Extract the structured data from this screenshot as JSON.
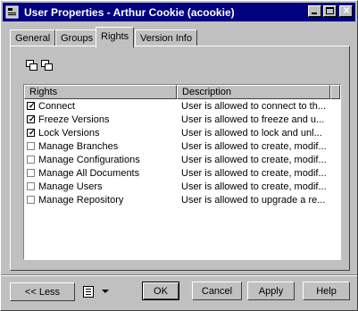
{
  "window": {
    "title": "User Properties - Arthur Cookie (acookie)"
  },
  "tabs": [
    {
      "label": "General"
    },
    {
      "label": "Groups"
    },
    {
      "label": "Rights"
    },
    {
      "label": "Version Info"
    }
  ],
  "rights_list": {
    "columns": [
      "Rights",
      "Description"
    ],
    "rows": [
      {
        "right": "Connect",
        "checked": true,
        "description": "User is allowed to connect to th..."
      },
      {
        "right": "Freeze Versions",
        "checked": true,
        "description": "User is allowed to freeze and u..."
      },
      {
        "right": "Lock Versions",
        "checked": true,
        "description": "User is allowed to lock and unl..."
      },
      {
        "right": "Manage Branches",
        "checked": false,
        "description": "User is allowed to create, modif..."
      },
      {
        "right": "Manage Configurations",
        "checked": false,
        "description": "User is allowed to create, modif..."
      },
      {
        "right": "Manage All Documents",
        "checked": false,
        "description": "User is allowed to create, modif..."
      },
      {
        "right": "Manage Users",
        "checked": false,
        "description": "User is allowed to create, modif..."
      },
      {
        "right": "Manage Repository",
        "checked": false,
        "description": "User is allowed to upgrade a re..."
      }
    ]
  },
  "buttons": {
    "less": "<< Less",
    "ok": "OK",
    "cancel": "Cancel",
    "apply": "Apply",
    "help": "Help"
  },
  "icons": {
    "app": "user-properties-icon",
    "toolbar": [
      "select-all-icon",
      "deselect-all-icon"
    ],
    "menu": "document-menu-icon"
  }
}
